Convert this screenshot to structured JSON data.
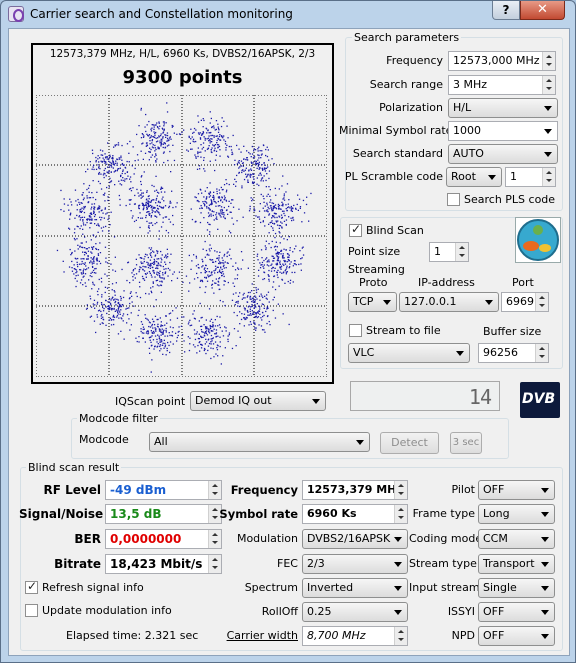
{
  "window": {
    "title": "Carrier search and Constellation monitoring",
    "help": "?",
    "close": "✕"
  },
  "plot": {
    "info": "12573,379 MHz, H/L, 6960 Ks, DVBS2/16APSK, 2/3",
    "points": "9300 points"
  },
  "search": {
    "title": "Search parameters",
    "frequency_label": "Frequency",
    "frequency_value": "12573,000 MHz",
    "range_label": "Search range",
    "range_value": "3 MHz",
    "polarization_label": "Polarization",
    "polarization_value": "H/L",
    "minsr_label": "Minimal Symbol rate",
    "minsr_value": "1000",
    "standard_label": "Search standard",
    "standard_value": "AUTO",
    "pls_label": "PL Scramble code",
    "pls_mode": "Root",
    "pls_value": "1",
    "search_pls_label": "Search PLS code"
  },
  "blind": {
    "label": "Blind Scan",
    "point_size_label": "Point size",
    "point_size_value": "1"
  },
  "streaming": {
    "title": "Streaming",
    "proto_label": "Proto",
    "ip_label": "IP-address",
    "port_label": "Port",
    "proto_value": "TCP",
    "ip_value": "127.0.0.1",
    "port_value": "6969",
    "stream_to_file_label": "Stream to file",
    "buffer_label": "Buffer size",
    "player_value": "VLC",
    "buffer_value": "96256"
  },
  "iq": {
    "label": "IQScan point",
    "value": "Demod IQ out",
    "display": "14"
  },
  "logo": {
    "text": "DVB"
  },
  "modcode": {
    "title": "Modcode filter",
    "label": "Modcode",
    "value": "All",
    "detect": "Detect",
    "sec": "3 sec"
  },
  "result": {
    "title": "Blind scan result",
    "rf_label": "RF Level",
    "rf_value": "-49 dBm",
    "sn_label": "Signal/Noise",
    "sn_value": "13,5 dB",
    "ber_label": "BER",
    "ber_value": "0,0000000",
    "bitrate_label": "Bitrate",
    "bitrate_value": "18,423 Mbit/s",
    "refresh_label": "Refresh signal info",
    "update_label": "Update modulation info",
    "elapsed": "Elapsed time: 2.321 sec",
    "freq_label": "Frequency",
    "freq_value": "12573,379 MHz",
    "sr_label": "Symbol rate",
    "sr_value": "6960 Ks",
    "mod_label": "Modulation",
    "mod_value": "DVBS2/16APSK",
    "fec_label": "FEC",
    "fec_value": "2/3",
    "spectrum_label": "Spectrum",
    "spectrum_value": "Inverted",
    "rolloff_label": "RollOff",
    "rolloff_value": "0.25",
    "cw_label": "Carrier width",
    "cw_value": "8,700 MHz",
    "pilot_label": "Pilot",
    "pilot_value": "OFF",
    "frame_label": "Frame type",
    "frame_value": "Long",
    "coding_label": "Coding mode",
    "coding_value": "CCM",
    "stype_label": "Stream type",
    "stype_value": "Transport",
    "istream_label": "Input stream",
    "istream_value": "Single",
    "issyi_label": "ISSYI",
    "issyi_value": "OFF",
    "npd_label": "NPD",
    "npd_value": "OFF"
  },
  "colors": {
    "rf": "#1a5fd1",
    "sn": "#1a8a1a",
    "ber": "#e00000",
    "points": "#1c1ca8"
  }
}
